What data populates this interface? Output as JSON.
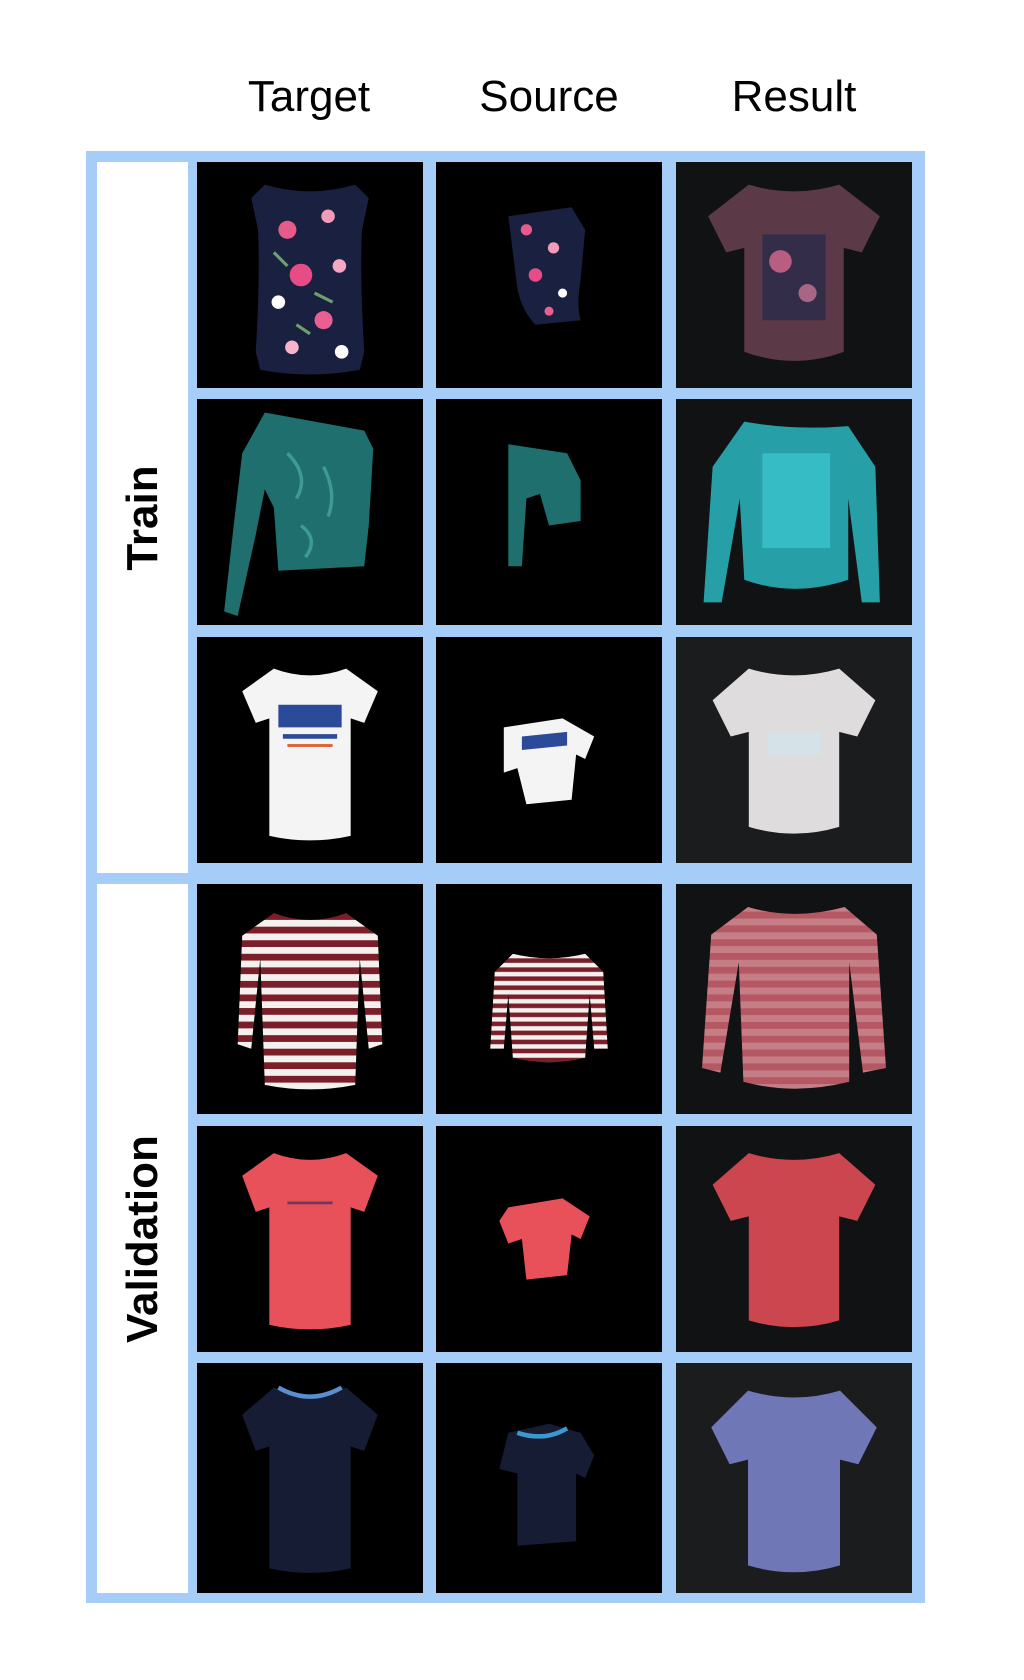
{
  "headers": {
    "target": "Target",
    "source": "Source",
    "result": "Result"
  },
  "groups": {
    "train": "Train",
    "validation": "Validation"
  },
  "rows": [
    {
      "group": "Train",
      "garment": "floral-sleeveless-blouse",
      "color": "#1a2040"
    },
    {
      "group": "Train",
      "garment": "one-shoulder-long-sleeve-top",
      "color": "#1e6f6e"
    },
    {
      "group": "Train",
      "garment": "white-graphic-tee",
      "color": "#f4f4f4"
    },
    {
      "group": "Validation",
      "garment": "striped-long-sleeve-shirt",
      "color": "#7a1f2a"
    },
    {
      "group": "Validation",
      "garment": "coral-tee",
      "color": "#e8505a"
    },
    {
      "group": "Validation",
      "garment": "navy-tee",
      "color": "#161c33"
    }
  ]
}
